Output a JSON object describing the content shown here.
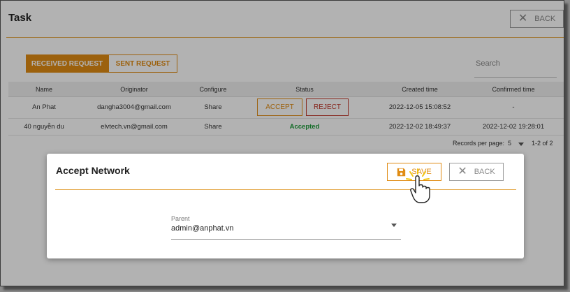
{
  "page": {
    "title": "Task",
    "back_label": "BACK"
  },
  "tabs": [
    {
      "label": "RECEIVED REQUEST",
      "active": true
    },
    {
      "label": "SENT REQUEST",
      "active": false
    }
  ],
  "search": {
    "placeholder": "Search"
  },
  "table": {
    "columns": [
      "Name",
      "Originator",
      "Configure",
      "Status",
      "Created time",
      "Confirmed time"
    ],
    "rows": [
      {
        "name": "An Phat",
        "originator": "dangha3004@gmail.com",
        "configure": "Share",
        "status_actions": [
          "ACCEPT",
          "REJECT"
        ],
        "created": "2022-12-05 15:08:52",
        "confirmed": "-"
      },
      {
        "name": "40 nguyễn du",
        "originator": "elvtech.vn@gmail.com",
        "configure": "Share",
        "status": "Accepted",
        "created": "2022-12-02 18:49:37",
        "confirmed": "2022-12-02 19:28:01"
      }
    ]
  },
  "pagination": {
    "records_label": "Records per page:",
    "per_page": "5",
    "range": "1-2 of 2"
  },
  "dialog": {
    "title": "Accept Network",
    "save_label": "SAVE",
    "back_label": "BACK",
    "parent_label": "Parent",
    "parent_value": "admin@anphat.vn"
  },
  "colors": {
    "accent": "#e08c14",
    "reject": "#c0392b",
    "accepted": "#1e9b3a"
  }
}
